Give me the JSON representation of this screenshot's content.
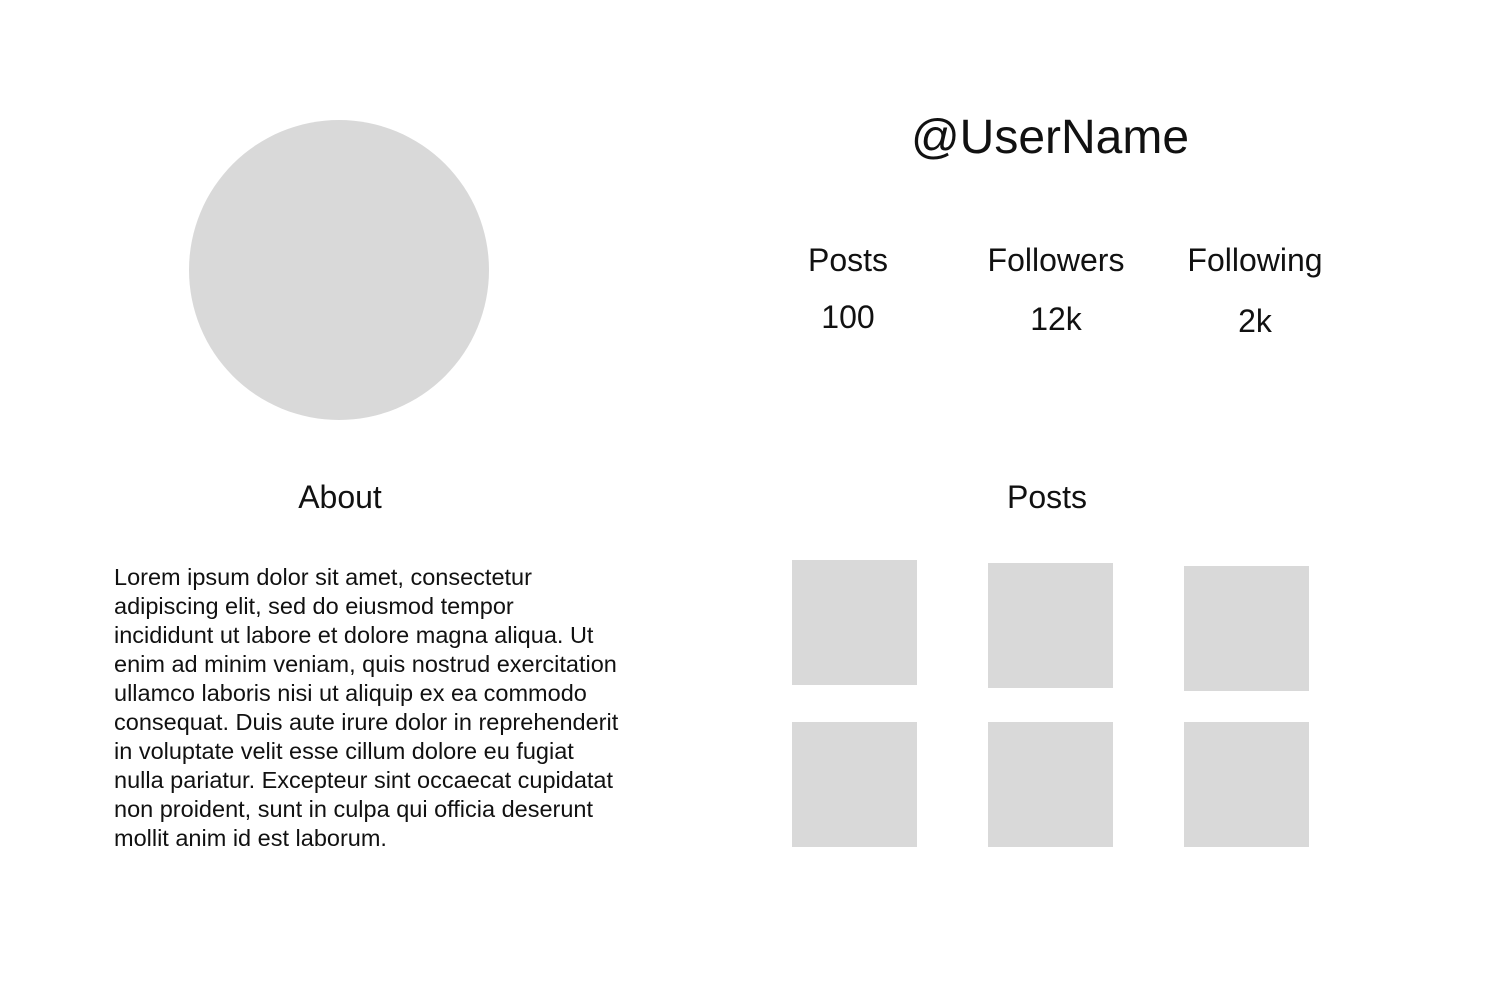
{
  "profile": {
    "username": "@UserName",
    "avatar_color": "#d9d9d9"
  },
  "stats": {
    "posts": {
      "label": "Posts",
      "value": "100"
    },
    "followers": {
      "label": "Followers",
      "value": "12k"
    },
    "following": {
      "label": "Following",
      "value": "2k"
    }
  },
  "about": {
    "heading": "About",
    "text": "Lorem ipsum dolor sit amet, consectetur adipiscing elit, sed do eiusmod tempor incididunt ut labore et dolore magna aliqua. Ut enim ad minim veniam, quis nostrud exercitation ullamco laboris nisi ut aliquip ex ea commodo consequat. Duis aute irure dolor in reprehenderit in voluptate velit esse cillum dolore eu fugiat nulla pariatur. Excepteur sint occaecat cupidatat non proident, sunt in culpa qui officia deserunt mollit anim id est laborum."
  },
  "posts_section": {
    "heading": "Posts",
    "placeholder_color": "#d9d9d9"
  }
}
